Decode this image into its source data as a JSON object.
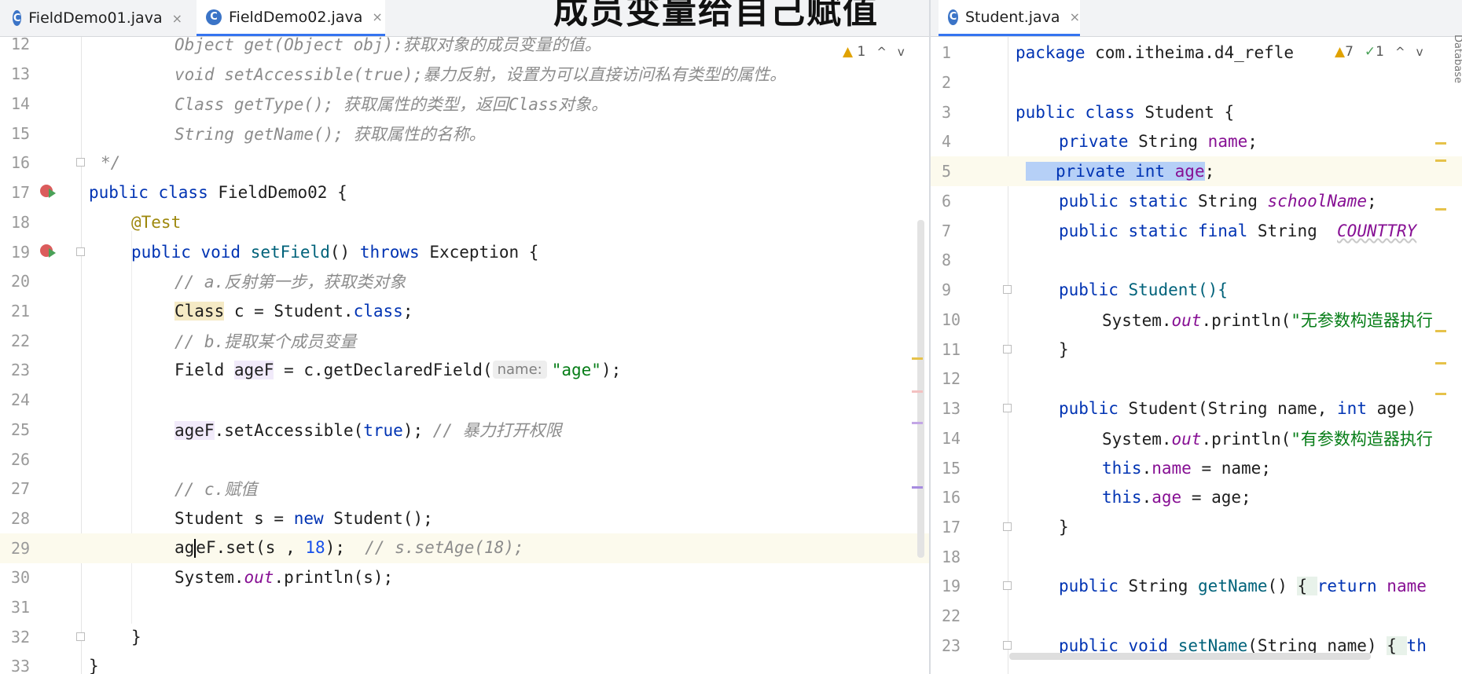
{
  "left": {
    "tabs": [
      {
        "label": "FieldDemo01.java",
        "icon": "C",
        "active": false,
        "close": "×"
      },
      {
        "label": "FieldDemo02.java",
        "icon": "C",
        "active": true,
        "close": "×"
      }
    ],
    "caption": "成员变量给自己赋值",
    "inspections": {
      "warnings": "1",
      "up": "^",
      "down": "v"
    },
    "line_numbers": [
      "12",
      "13",
      "14",
      "15",
      "16",
      "17",
      "18",
      "19",
      "20",
      "21",
      "22",
      "23",
      "24",
      "25",
      "26",
      "27",
      "28",
      "29",
      "30",
      "31",
      "32",
      "33"
    ],
    "code": {
      "l12": "Object get(Object obj):获取对象的成员变量的值。",
      "l13": "void setAccessible(true);暴力反射，设置为可以直接访问私有类型的属性。",
      "l14": "Class getType(); 获取属性的类型，返回Class对象。",
      "l15": "String getName(); 获取属性的名称。",
      "l16": "*/",
      "l17_kw": "public class ",
      "l17_rest": "FieldDemo02 {",
      "l18": "@Test",
      "l19_kw1": "public void ",
      "l19_fn": "setField",
      "l19_mid": "() ",
      "l19_kw2": "throws ",
      "l19_rest": "Exception {",
      "l20": "// a.反射第一步，获取类对象",
      "l21_cls": "Class",
      "l21_mid": " c = Student.",
      "l21_kw": "class",
      "l21_end": ";",
      "l22": "// b.提取某个成员变量",
      "l23_a": "Field ",
      "l23_var": "ageF",
      "l23_b": " = c.getDeclaredField(",
      "l23_hint": "name:",
      "l23_str": "\"age\"",
      "l23_end": ");",
      "l25_var": "ageF",
      "l25_a": ".setAccessible(",
      "l25_kw": "true",
      "l25_b": "); ",
      "l25_cmt": "// 暴力打开权限",
      "l27": "// c.赋值",
      "l28_a": "Student s = ",
      "l28_kw": "new ",
      "l28_b": "Student();",
      "l29_a": "ag",
      "l29_b": "eF",
      "l29_c": ".set(s , ",
      "l29_num": "18",
      "l29_d": ");  ",
      "l29_cmt": "// s.setAge(18);",
      "l30_a": "System.",
      "l30_out": "out",
      "l30_b": ".println(s);",
      "l32": "}",
      "l33": "}"
    }
  },
  "right": {
    "tabs": [
      {
        "label": "Student.java",
        "icon": "C",
        "active": true,
        "close": "×"
      }
    ],
    "inspections": {
      "warnings": "7",
      "ok": "1",
      "up": "^",
      "down": "v"
    },
    "edge_label": "Database",
    "line_numbers": [
      "1",
      "2",
      "3",
      "4",
      "5",
      "6",
      "7",
      "8",
      "9",
      "10",
      "11",
      "12",
      "13",
      "14",
      "15",
      "16",
      "17",
      "18",
      "19",
      "22",
      "23"
    ],
    "code": {
      "r1_kw": "package ",
      "r1_rest": "com.itheima.d4_refle",
      "r3_kw": "public class ",
      "r3_rest": "Student {",
      "r4_kw": "private ",
      "r4_a": "String ",
      "r4_f": "name",
      "r4_end": ";",
      "r5_kw": "private int ",
      "r5_f": "age",
      "r5_end": ";",
      "r6_kw": "public static ",
      "r6_a": "String ",
      "r6_f": "schoolName",
      "r6_end": ";",
      "r7_kw": "public static final ",
      "r7_a": "String  ",
      "r7_f": "COUNTTRY",
      "r9_kw": "public ",
      "r9_rest": "Student(){",
      "r10_a": "System.",
      "r10_out": "out",
      "r10_b": ".println(",
      "r10_str": "\"无参数构造器执行",
      "r11": "}",
      "r13_kw": "public ",
      "r13_a": "Student(String name, ",
      "r13_kw2": "int ",
      "r13_b": "age)",
      "r14_a": "System.",
      "r14_out": "out",
      "r14_b": ".println(",
      "r14_str": "\"有参数构造器执行",
      "r15_kw": "this",
      "r15_a": ".",
      "r15_f": "name",
      "r15_b": " = name;",
      "r16_kw": "this",
      "r16_a": ".",
      "r16_f": "age",
      "r16_b": " = age;",
      "r17": "}",
      "r19_kw": "public ",
      "r19_a": "String ",
      "r19_fn": "getName",
      "r19_b": "() ",
      "r19_c": "{ ",
      "r19_kw2": "return ",
      "r19_f": "name",
      "r23_kw": "public void ",
      "r23_fn": "setName",
      "r23_a": "(String name) ",
      "r23_b": "{ ",
      "r23_kw2": "th"
    }
  },
  "colors": {
    "keyword": "#0033b3",
    "comment": "#8c8c8c",
    "string": "#067d17",
    "number": "#1750eb",
    "field": "#871094",
    "annotation": "#9e880d",
    "selection": "#b6d0f7",
    "tab_accent": "#3574f0"
  }
}
